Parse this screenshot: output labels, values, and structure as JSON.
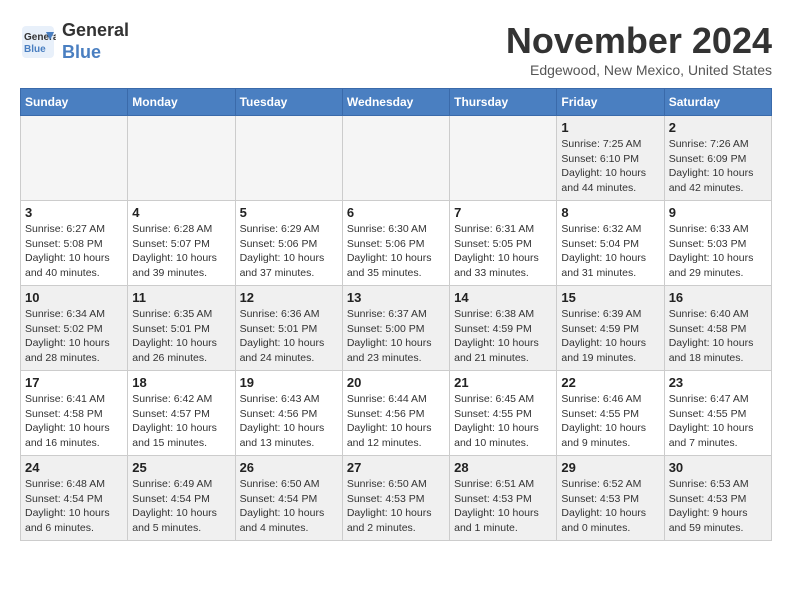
{
  "logo": {
    "line1": "General",
    "line2": "Blue"
  },
  "title": "November 2024",
  "location": "Edgewood, New Mexico, United States",
  "days_of_week": [
    "Sunday",
    "Monday",
    "Tuesday",
    "Wednesday",
    "Thursday",
    "Friday",
    "Saturday"
  ],
  "weeks": [
    [
      {
        "day": "",
        "info": "",
        "empty": true
      },
      {
        "day": "",
        "info": "",
        "empty": true
      },
      {
        "day": "",
        "info": "",
        "empty": true
      },
      {
        "day": "",
        "info": "",
        "empty": true
      },
      {
        "day": "",
        "info": "",
        "empty": true
      },
      {
        "day": "1",
        "info": "Sunrise: 7:25 AM\nSunset: 6:10 PM\nDaylight: 10 hours and 44 minutes."
      },
      {
        "day": "2",
        "info": "Sunrise: 7:26 AM\nSunset: 6:09 PM\nDaylight: 10 hours and 42 minutes."
      }
    ],
    [
      {
        "day": "3",
        "info": "Sunrise: 6:27 AM\nSunset: 5:08 PM\nDaylight: 10 hours and 40 minutes."
      },
      {
        "day": "4",
        "info": "Sunrise: 6:28 AM\nSunset: 5:07 PM\nDaylight: 10 hours and 39 minutes."
      },
      {
        "day": "5",
        "info": "Sunrise: 6:29 AM\nSunset: 5:06 PM\nDaylight: 10 hours and 37 minutes."
      },
      {
        "day": "6",
        "info": "Sunrise: 6:30 AM\nSunset: 5:06 PM\nDaylight: 10 hours and 35 minutes."
      },
      {
        "day": "7",
        "info": "Sunrise: 6:31 AM\nSunset: 5:05 PM\nDaylight: 10 hours and 33 minutes."
      },
      {
        "day": "8",
        "info": "Sunrise: 6:32 AM\nSunset: 5:04 PM\nDaylight: 10 hours and 31 minutes."
      },
      {
        "day": "9",
        "info": "Sunrise: 6:33 AM\nSunset: 5:03 PM\nDaylight: 10 hours and 29 minutes."
      }
    ],
    [
      {
        "day": "10",
        "info": "Sunrise: 6:34 AM\nSunset: 5:02 PM\nDaylight: 10 hours and 28 minutes."
      },
      {
        "day": "11",
        "info": "Sunrise: 6:35 AM\nSunset: 5:01 PM\nDaylight: 10 hours and 26 minutes."
      },
      {
        "day": "12",
        "info": "Sunrise: 6:36 AM\nSunset: 5:01 PM\nDaylight: 10 hours and 24 minutes."
      },
      {
        "day": "13",
        "info": "Sunrise: 6:37 AM\nSunset: 5:00 PM\nDaylight: 10 hours and 23 minutes."
      },
      {
        "day": "14",
        "info": "Sunrise: 6:38 AM\nSunset: 4:59 PM\nDaylight: 10 hours and 21 minutes."
      },
      {
        "day": "15",
        "info": "Sunrise: 6:39 AM\nSunset: 4:59 PM\nDaylight: 10 hours and 19 minutes."
      },
      {
        "day": "16",
        "info": "Sunrise: 6:40 AM\nSunset: 4:58 PM\nDaylight: 10 hours and 18 minutes."
      }
    ],
    [
      {
        "day": "17",
        "info": "Sunrise: 6:41 AM\nSunset: 4:58 PM\nDaylight: 10 hours and 16 minutes."
      },
      {
        "day": "18",
        "info": "Sunrise: 6:42 AM\nSunset: 4:57 PM\nDaylight: 10 hours and 15 minutes."
      },
      {
        "day": "19",
        "info": "Sunrise: 6:43 AM\nSunset: 4:56 PM\nDaylight: 10 hours and 13 minutes."
      },
      {
        "day": "20",
        "info": "Sunrise: 6:44 AM\nSunset: 4:56 PM\nDaylight: 10 hours and 12 minutes."
      },
      {
        "day": "21",
        "info": "Sunrise: 6:45 AM\nSunset: 4:55 PM\nDaylight: 10 hours and 10 minutes."
      },
      {
        "day": "22",
        "info": "Sunrise: 6:46 AM\nSunset: 4:55 PM\nDaylight: 10 hours and 9 minutes."
      },
      {
        "day": "23",
        "info": "Sunrise: 6:47 AM\nSunset: 4:55 PM\nDaylight: 10 hours and 7 minutes."
      }
    ],
    [
      {
        "day": "24",
        "info": "Sunrise: 6:48 AM\nSunset: 4:54 PM\nDaylight: 10 hours and 6 minutes."
      },
      {
        "day": "25",
        "info": "Sunrise: 6:49 AM\nSunset: 4:54 PM\nDaylight: 10 hours and 5 minutes."
      },
      {
        "day": "26",
        "info": "Sunrise: 6:50 AM\nSunset: 4:54 PM\nDaylight: 10 hours and 4 minutes."
      },
      {
        "day": "27",
        "info": "Sunrise: 6:50 AM\nSunset: 4:53 PM\nDaylight: 10 hours and 2 minutes."
      },
      {
        "day": "28",
        "info": "Sunrise: 6:51 AM\nSunset: 4:53 PM\nDaylight: 10 hours and 1 minute."
      },
      {
        "day": "29",
        "info": "Sunrise: 6:52 AM\nSunset: 4:53 PM\nDaylight: 10 hours and 0 minutes."
      },
      {
        "day": "30",
        "info": "Sunrise: 6:53 AM\nSunset: 4:53 PM\nDaylight: 9 hours and 59 minutes."
      }
    ]
  ]
}
